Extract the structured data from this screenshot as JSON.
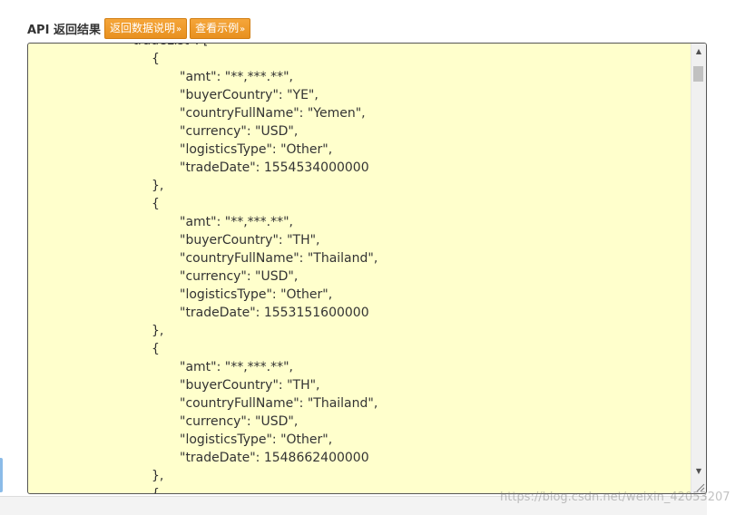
{
  "header": {
    "title": "API 返回结果",
    "btn_description": "返回数据说明",
    "btn_example": "查看示例",
    "btn_arrow": "»"
  },
  "code": {
    "partial_top": "\"tradeList\": [",
    "open_brace": "{",
    "close_brace_comma": "},",
    "records": [
      {
        "amt": "\"amt\": \"**,***.**\",",
        "buyerCountry": "\"buyerCountry\": \"YE\",",
        "countryFullName": "\"countryFullName\": \"Yemen\",",
        "currency": "\"currency\": \"USD\",",
        "logisticsType": "\"logisticsType\": \"Other\",",
        "tradeDate": "\"tradeDate\": 1554534000000"
      },
      {
        "amt": "\"amt\": \"**,***.**\",",
        "buyerCountry": "\"buyerCountry\": \"TH\",",
        "countryFullName": "\"countryFullName\": \"Thailand\",",
        "currency": "\"currency\": \"USD\",",
        "logisticsType": "\"logisticsType\": \"Other\",",
        "tradeDate": "\"tradeDate\": 1553151600000"
      },
      {
        "amt": "\"amt\": \"**,***.**\",",
        "buyerCountry": "\"buyerCountry\": \"TH\",",
        "countryFullName": "\"countryFullName\": \"Thailand\",",
        "currency": "\"currency\": \"USD\",",
        "logisticsType": "\"logisticsType\": \"Other\",",
        "tradeDate": "\"tradeDate\": 1548662400000"
      }
    ]
  },
  "watermark": "https://blog.csdn.net/weixin_42053207",
  "colors": {
    "box_background": "#ffffcc",
    "button_orange": "#f29b2e",
    "text": "#333333"
  }
}
